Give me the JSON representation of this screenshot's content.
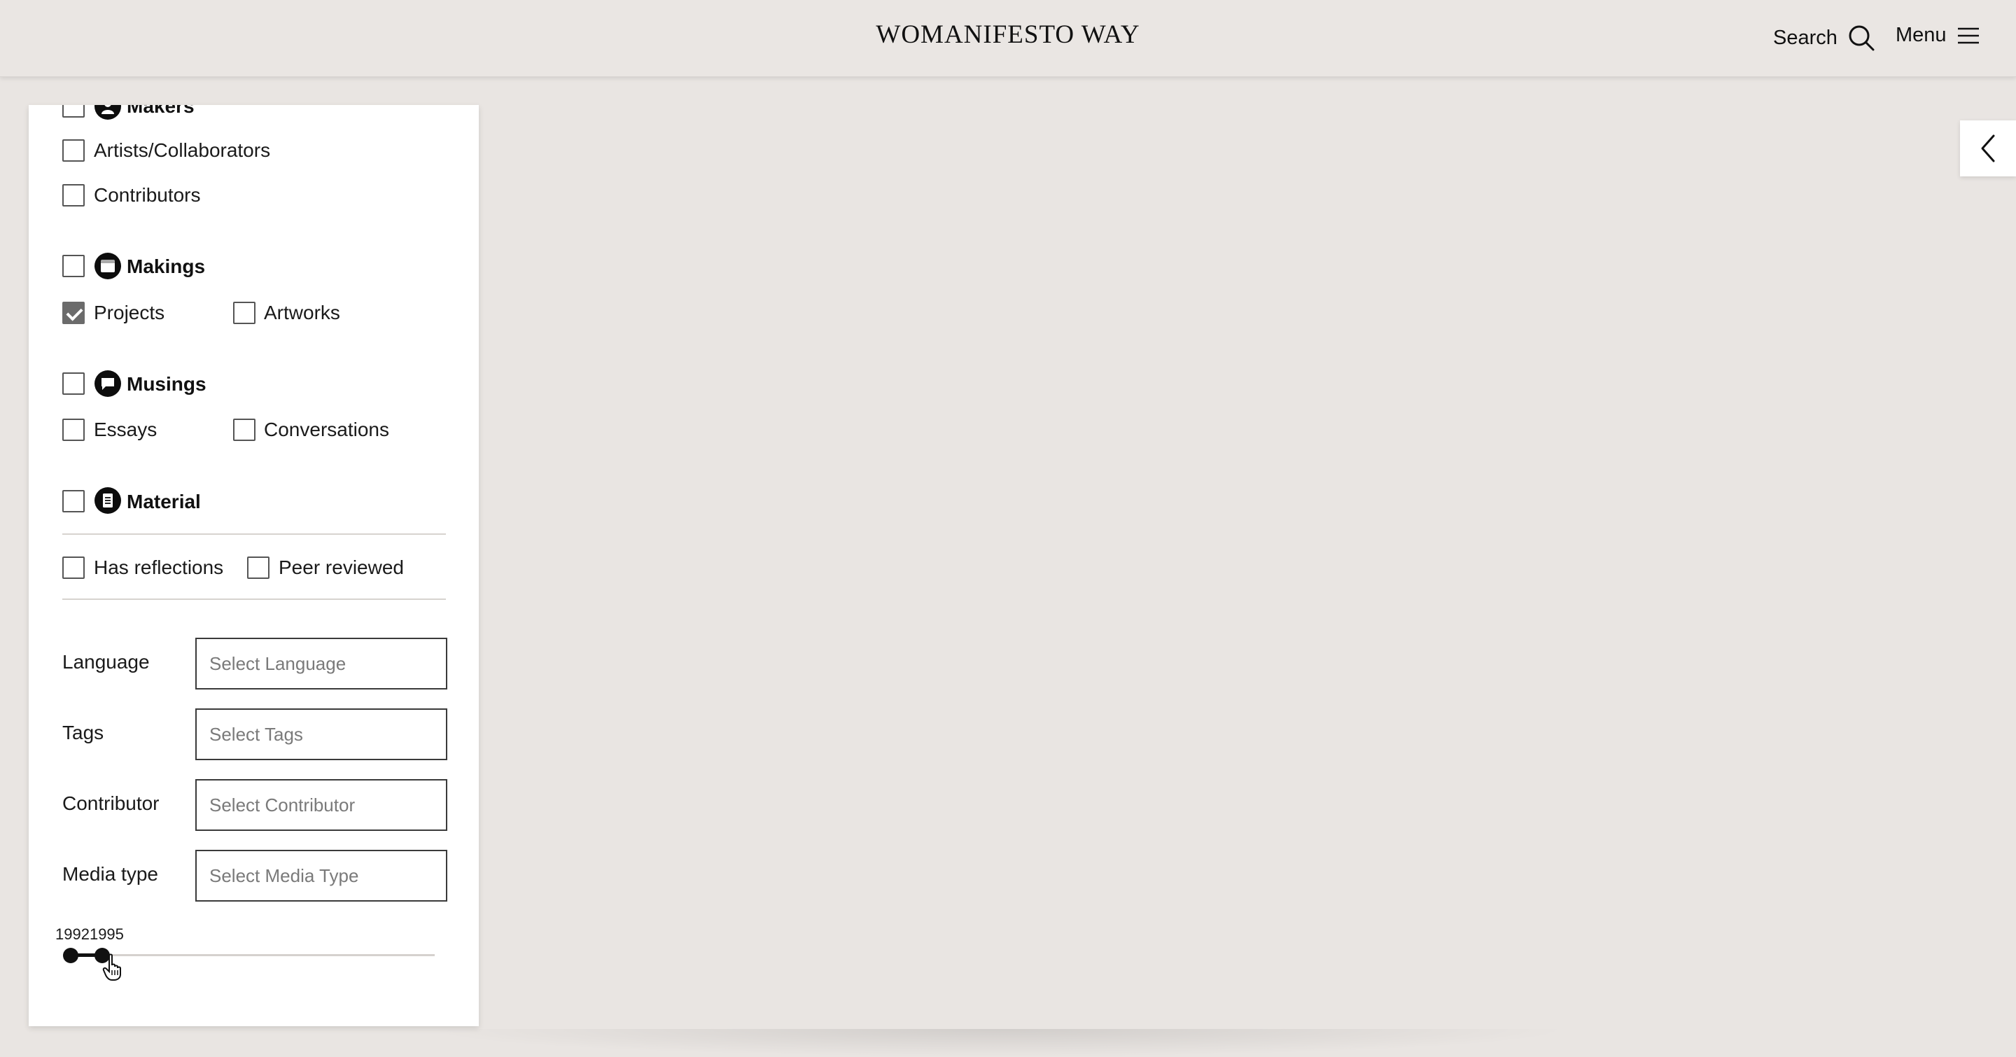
{
  "header": {
    "brand": "WOMANIFESTO WAY",
    "search_label": "Search",
    "menu_label": "Menu"
  },
  "filters": {
    "makers": {
      "title": "Makers",
      "checked": false,
      "items": [
        {
          "label": "Artists/Collaborators",
          "checked": false
        },
        {
          "label": "Contributors",
          "checked": false
        }
      ]
    },
    "makings": {
      "title": "Makings",
      "checked": false,
      "items": [
        {
          "label": "Projects",
          "checked": true
        },
        {
          "label": "Artworks",
          "checked": false
        }
      ]
    },
    "musings": {
      "title": "Musings",
      "checked": false,
      "items": [
        {
          "label": "Essays",
          "checked": false
        },
        {
          "label": "Conversations",
          "checked": false
        }
      ]
    },
    "material": {
      "title": "Material",
      "checked": false
    },
    "extras": [
      {
        "label": "Has reflections",
        "checked": false
      },
      {
        "label": "Peer reviewed",
        "checked": false
      }
    ],
    "fields": [
      {
        "label": "Language",
        "placeholder": "Select Language"
      },
      {
        "label": "Tags",
        "placeholder": "Select Tags"
      },
      {
        "label": "Contributor",
        "placeholder": "Select Contributor"
      },
      {
        "label": "Media type",
        "placeholder": "Select Media Type"
      }
    ],
    "year_range": {
      "from": "1992",
      "to": "1995"
    }
  },
  "icons": {
    "search": "search-icon",
    "menu": "hamburger-icon",
    "collapse": "chevron-left-icon",
    "makers": "person-icon",
    "makings": "window-icon",
    "musings": "speech-bubble-icon",
    "material": "document-icon"
  },
  "colors": {
    "background": "#e9e5e2",
    "panel": "#ffffff",
    "checked": "#6b6b6b",
    "text": "#1a1a1a"
  }
}
